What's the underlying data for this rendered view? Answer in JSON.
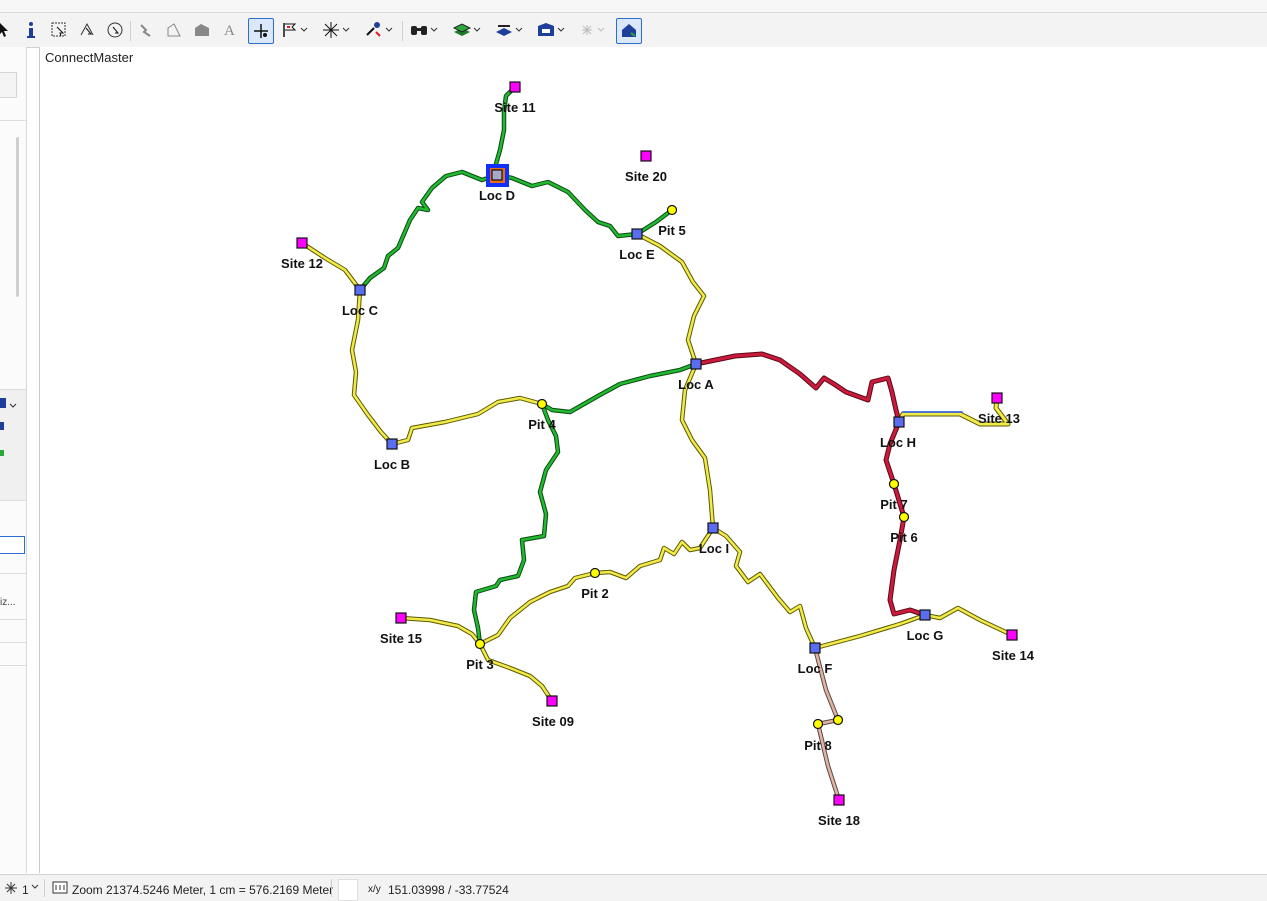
{
  "map_window": {
    "title": "ConnectMaster"
  },
  "toolbar": {
    "icons": [
      "select-arrow",
      "info",
      "select-rect",
      "select-node",
      "select-circle",
      "pin",
      "draw-line",
      "draw-polygon",
      "text",
      "add-node",
      "flag-route",
      "snap",
      "find-route",
      "binoculars",
      "layers",
      "edit-geometry",
      "network",
      "sparkle",
      "home-route"
    ]
  },
  "status": {
    "cursor_count": "1",
    "zoom_text": "Zoom 21374.5246 Meter, 1 cm = 576.2169 Meter",
    "xy_label": "x/y",
    "xy_value": "151.03998 / -33.77524"
  },
  "colors": {
    "green": "#22b830",
    "yellow": "#f2ea4a",
    "red": "#cc1a3c",
    "blue": "#3a63d8",
    "pink": "#e2b4a6",
    "magenta": "#ff00ff",
    "loc": "#5a6cf0"
  },
  "map": {
    "locations": [
      {
        "name": "Loc A"
      },
      {
        "name": "Loc B"
      },
      {
        "name": "Loc C"
      },
      {
        "name": "Loc D"
      },
      {
        "name": "Loc E"
      },
      {
        "name": "Loc F"
      },
      {
        "name": "Loc G"
      },
      {
        "name": "Loc H"
      },
      {
        "name": "Loc I"
      }
    ],
    "sites": [
      {
        "name": "Site 11"
      },
      {
        "name": "Site 20"
      },
      {
        "name": "Site 12"
      },
      {
        "name": "Site 13"
      },
      {
        "name": "Site 15"
      },
      {
        "name": "Site 09"
      },
      {
        "name": "Site 14"
      },
      {
        "name": "Site 18"
      }
    ],
    "pits": [
      {
        "name": "Pit 5"
      },
      {
        "name": "Pit 4"
      },
      {
        "name": "Pit 7"
      },
      {
        "name": "Pit 6"
      },
      {
        "name": "Pit 2"
      },
      {
        "name": "Pit 3"
      },
      {
        "name": "Pit 8"
      }
    ]
  }
}
